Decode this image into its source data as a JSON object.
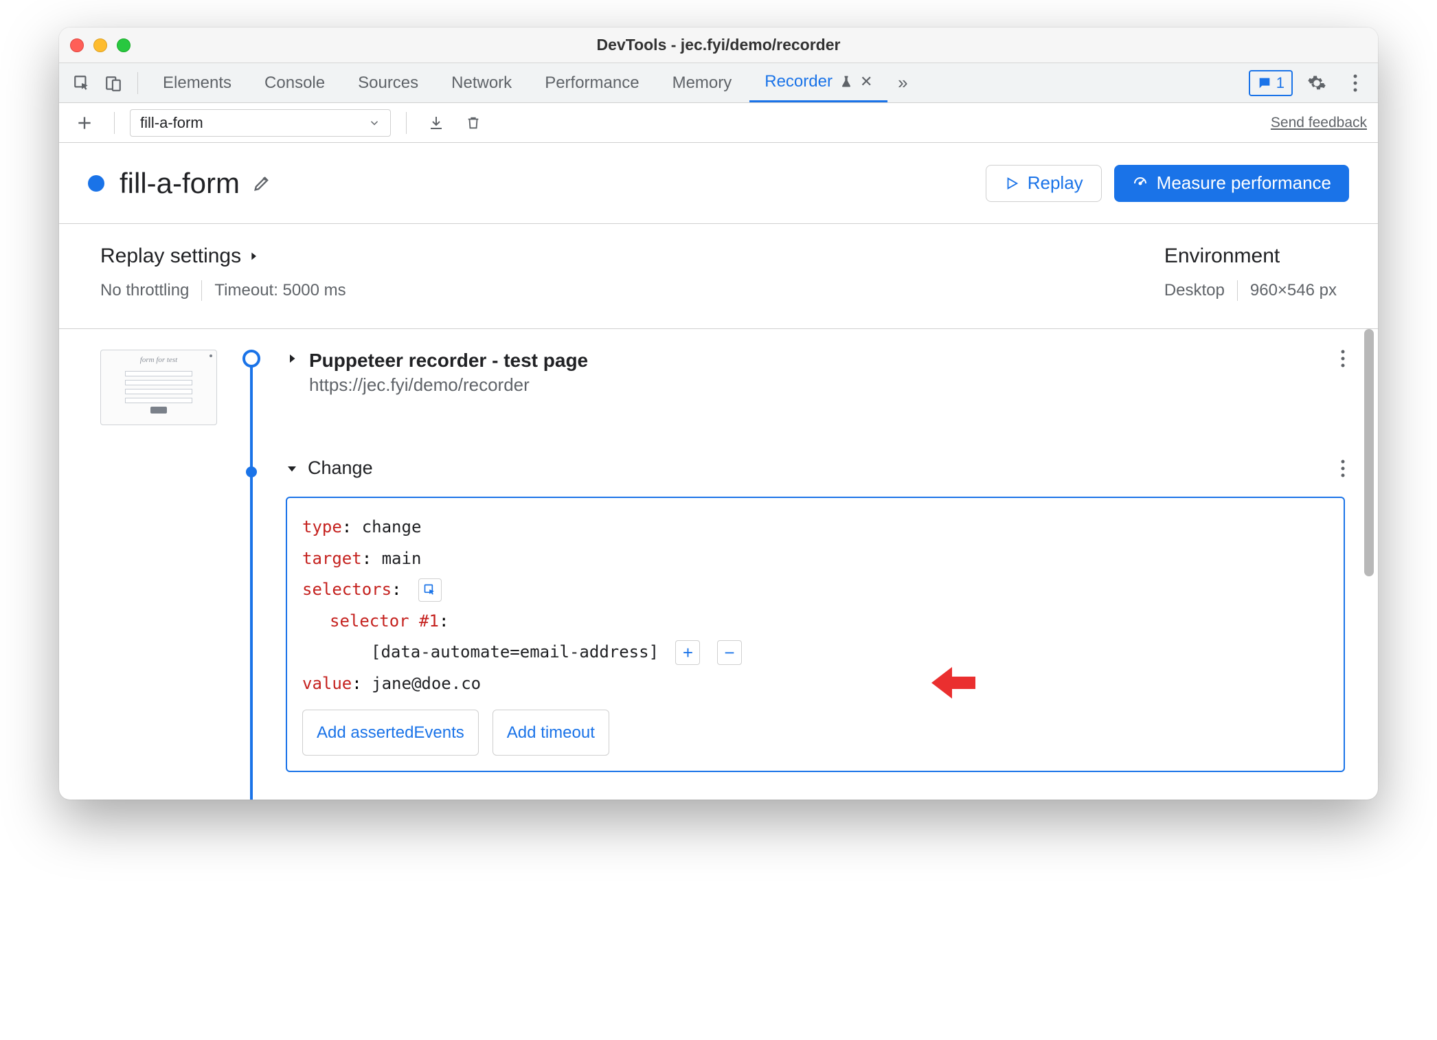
{
  "window": {
    "title": "DevTools - jec.fyi/demo/recorder"
  },
  "tabs": {
    "items": [
      "Elements",
      "Console",
      "Sources",
      "Network",
      "Performance",
      "Memory",
      "Recorder"
    ],
    "active": "Recorder",
    "messages_count": "1"
  },
  "toolbar": {
    "recording_name": "fill-a-form",
    "send_feedback": "Send feedback"
  },
  "header": {
    "title": "fill-a-form",
    "replay_label": "Replay",
    "measure_label": "Measure performance"
  },
  "settings": {
    "replay_heading": "Replay settings",
    "throttling": "No throttling",
    "timeout": "Timeout: 5000 ms",
    "env_heading": "Environment",
    "env_device": "Desktop",
    "env_size": "960×546 px"
  },
  "steps": {
    "first": {
      "title": "Puppeteer recorder - test page",
      "url": "https://jec.fyi/demo/recorder"
    },
    "change": {
      "label": "Change",
      "props": {
        "type_key": "type",
        "type_val": "change",
        "target_key": "target",
        "target_val": "main",
        "selectors_key": "selectors",
        "selector1_key": "selector #1",
        "selector1_val": "[data-automate=email-address]",
        "value_key": "value",
        "value_val": "jane@doe.co"
      },
      "add_asserted": "Add assertedEvents",
      "add_timeout": "Add timeout"
    }
  }
}
